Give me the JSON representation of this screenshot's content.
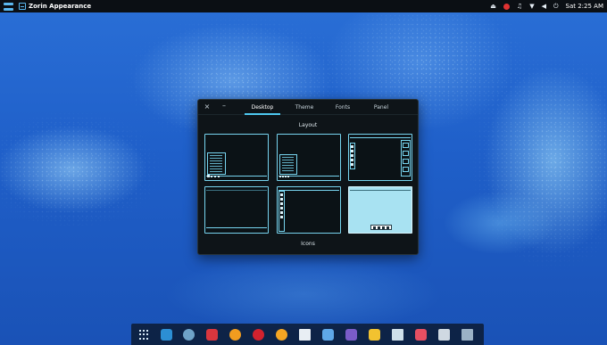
{
  "top_panel": {
    "app_name": "Zorin Appearance",
    "clock": "Sat 2:25 AM",
    "icons": [
      "zorin-logo-icon",
      "eject-icon",
      "red-indicator-icon",
      "music-icon",
      "wifi-icon",
      "volume-icon",
      "power-icon"
    ],
    "glyphs": {
      "eject": "⏏",
      "music": "♫",
      "wifi": "▼",
      "volume": "◀",
      "power": "⏻"
    }
  },
  "window": {
    "close_glyph": "×",
    "minimize_glyph": "–",
    "tabs": [
      "Desktop",
      "Theme",
      "Fonts",
      "Panel"
    ],
    "active_tab": "Desktop",
    "section_layout": "Layout",
    "section_icons": "Icons",
    "layouts": [
      "taskbar-bottom-with-menu",
      "taskbar-bottom-dock-menu",
      "side-dock-right",
      "panel-bottom-minimal",
      "side-dock-left",
      "dock-bottom-selected"
    ],
    "selected_layout_index": 5
  },
  "dock": {
    "items": [
      {
        "icon": "app-grid-icon",
        "color": "#d4e6f4"
      },
      {
        "icon": "store-icon",
        "color": "#2c8fd4"
      },
      {
        "icon": "chrome-icon",
        "color": "#6fa3c9"
      },
      {
        "icon": "vivaldi-icon",
        "color": "#d9363e"
      },
      {
        "icon": "firefox-icon",
        "color": "#f29c1f"
      },
      {
        "icon": "opera-icon",
        "color": "#d3222e"
      },
      {
        "icon": "messenger-icon",
        "color": "#f5a623"
      },
      {
        "icon": "document-icon",
        "color": "#e8eef4"
      },
      {
        "icon": "package-icon",
        "color": "#5fa8e8"
      },
      {
        "icon": "visual-studio-icon",
        "color": "#7a5cc8"
      },
      {
        "icon": "notes-icon",
        "color": "#f2c230"
      },
      {
        "icon": "files-icon",
        "color": "#cfe0ea"
      },
      {
        "icon": "draw-icon",
        "color": "#e64f62"
      },
      {
        "icon": "disk-icon",
        "color": "#cfd9e2"
      },
      {
        "icon": "window-icon",
        "color": "#9bb2c6"
      }
    ]
  }
}
